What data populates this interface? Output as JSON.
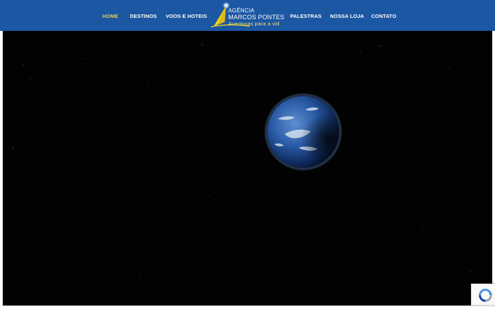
{
  "navbar": {
    "items_left": [
      {
        "label": "HOME",
        "active": true
      },
      {
        "label": "DESTINOS",
        "active": false
      },
      {
        "label": "VOOS E HOTEIS",
        "active": false
      }
    ],
    "items_right": [
      {
        "label": "PALESTRAS",
        "active": false
      },
      {
        "label": "NOSSA LOJA",
        "active": false
      },
      {
        "label": "CONTATO",
        "active": false
      }
    ],
    "logo": {
      "line1": "AGÊNCIA",
      "line2": "MARCOS PONTES",
      "tagline": "Aventuras para a vid"
    }
  },
  "hero": {
    "content": "earth-video-frame"
  },
  "widgets": {
    "recaptcha_icon": "recaptcha-icon"
  },
  "colors": {
    "nav_background": "#1c57a3",
    "nav_active": "#f2d21b",
    "hero_background": "#020203"
  }
}
